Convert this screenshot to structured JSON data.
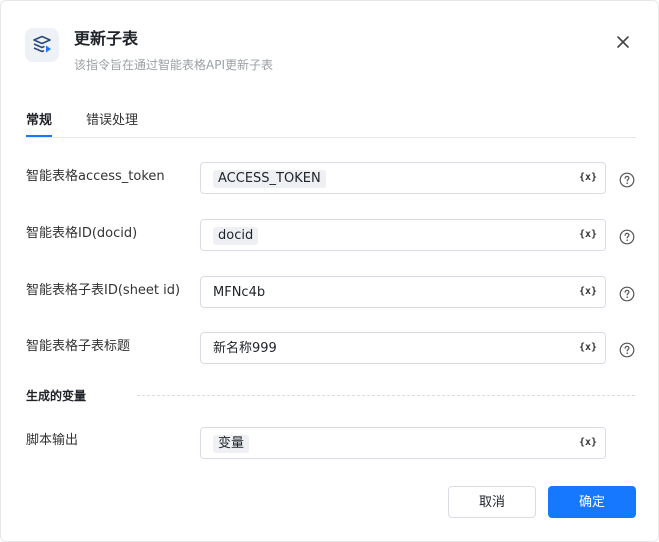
{
  "dialog": {
    "title": "更新子表",
    "subtitle": "该指令旨在通过智能表格API更新子表",
    "icon": "table-update-icon",
    "close_icon": "close-icon"
  },
  "tabs": [
    {
      "label": "常规",
      "active": true
    },
    {
      "label": "错误处理",
      "active": false
    }
  ],
  "fields": [
    {
      "label": "智能表格access_token",
      "value": "ACCESS_TOKEN",
      "value_type": "variable-tag"
    },
    {
      "label": "智能表格ID(docid)",
      "value": "docid",
      "value_type": "variable-tag"
    },
    {
      "label": "智能表格子表ID(sheet id)",
      "value": "MFNc4b",
      "value_type": "text"
    },
    {
      "label": "智能表格子表标题",
      "value": "新名称999",
      "value_type": "text"
    }
  ],
  "variable_button_label": "{x}",
  "output_section": {
    "title": "生成的变量",
    "fields": [
      {
        "label": "脚本输出",
        "value": "变量",
        "value_type": "variable-tag"
      }
    ]
  },
  "footer": {
    "cancel_label": "取消",
    "ok_label": "确定"
  },
  "colors": {
    "primary": "#1677ff",
    "tag_background": "#eef0f3",
    "icon_background": "#eef1f6"
  }
}
